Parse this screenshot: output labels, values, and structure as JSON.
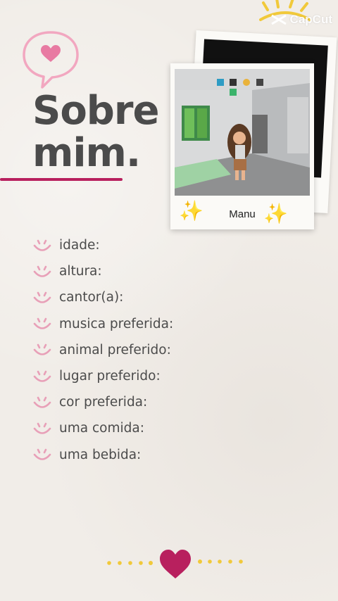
{
  "watermark": {
    "text": "CapCut"
  },
  "title": {
    "line1": "Sobre",
    "line2": "mim."
  },
  "photo": {
    "caption": "Manu"
  },
  "about_items": [
    {
      "label": "idade:"
    },
    {
      "label": "altura:"
    },
    {
      "label": "cantor(a):"
    },
    {
      "label": "musica preferida:"
    },
    {
      "label": "animal preferido:"
    },
    {
      "label": "lugar preferido:"
    },
    {
      "label": "cor preferida:"
    },
    {
      "label": "uma comida:"
    },
    {
      "label": "uma bebida:"
    }
  ],
  "colors": {
    "background": "#f1ede8",
    "text": "#4b4b4b",
    "accent": "#b8205e",
    "pink_light": "#f2a7c0",
    "smiley": "#e8a0b8",
    "dots": "#f1c93a"
  },
  "icons": [
    "heart-speech-bubble-icon",
    "smiley-icon",
    "sparkles-icon",
    "heart-icon",
    "capcut-logo-icon"
  ]
}
